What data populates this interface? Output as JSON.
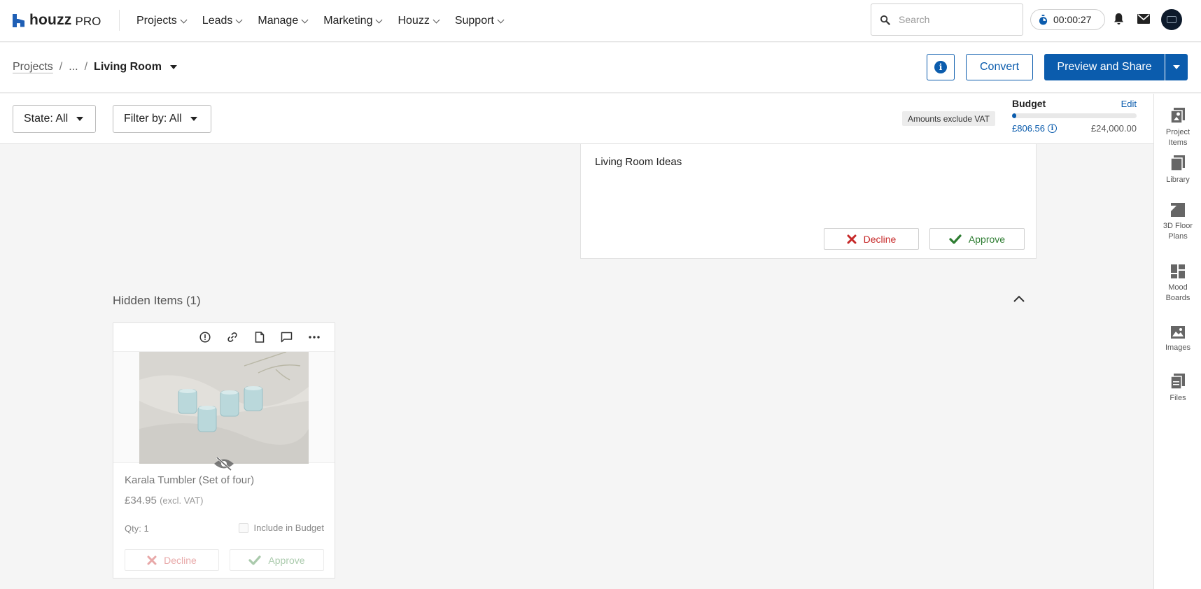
{
  "brand": {
    "name": "houzz",
    "suffix": "PRO"
  },
  "nav": {
    "items": [
      {
        "label": "Projects"
      },
      {
        "label": "Leads"
      },
      {
        "label": "Manage"
      },
      {
        "label": "Marketing"
      },
      {
        "label": "Houzz"
      },
      {
        "label": "Support"
      }
    ],
    "search_placeholder": "Search",
    "timer": "00:00:27"
  },
  "header": {
    "breadcrumb_root": "Projects",
    "breadcrumb_ellipsis": "...",
    "breadcrumb_current": "Living Room",
    "convert_label": "Convert",
    "preview_label": "Preview and Share"
  },
  "filters": {
    "state_label": "State: All",
    "filter_label": "Filter by: All",
    "vat_note": "Amounts exclude VAT"
  },
  "budget": {
    "label": "Budget",
    "edit_label": "Edit",
    "spent": "£806.56",
    "total": "£24,000.00",
    "progress_fraction": 0.034
  },
  "rail": {
    "items": [
      {
        "label1": "Project",
        "label2": "Items",
        "icon": "project-items-icon"
      },
      {
        "label1": "Library",
        "label2": "",
        "icon": "library-icon"
      },
      {
        "label1": "3D Floor",
        "label2": "Plans",
        "icon": "floor-plans-icon"
      },
      {
        "label1": "Mood",
        "label2": "Boards",
        "icon": "mood-boards-icon"
      },
      {
        "label1": "Images",
        "label2": "",
        "icon": "images-icon"
      },
      {
        "label1": "Files",
        "label2": "",
        "icon": "files-icon"
      }
    ]
  },
  "ideas": {
    "title": "Living Room Ideas",
    "decline_label": "Decline",
    "approve_label": "Approve"
  },
  "hidden": {
    "title": "Hidden Items (1)",
    "item": {
      "name": "Karala Tumbler (Set of four)",
      "price": "£34.95",
      "price_note": "(excl. VAT)",
      "qty": "Qty: 1",
      "include_label": "Include in Budget",
      "decline_label": "Decline",
      "approve_label": "Approve"
    }
  },
  "colors": {
    "brand_blue": "#0b5cad",
    "decline_red": "#c62828",
    "approve_green": "#2e7d32"
  }
}
